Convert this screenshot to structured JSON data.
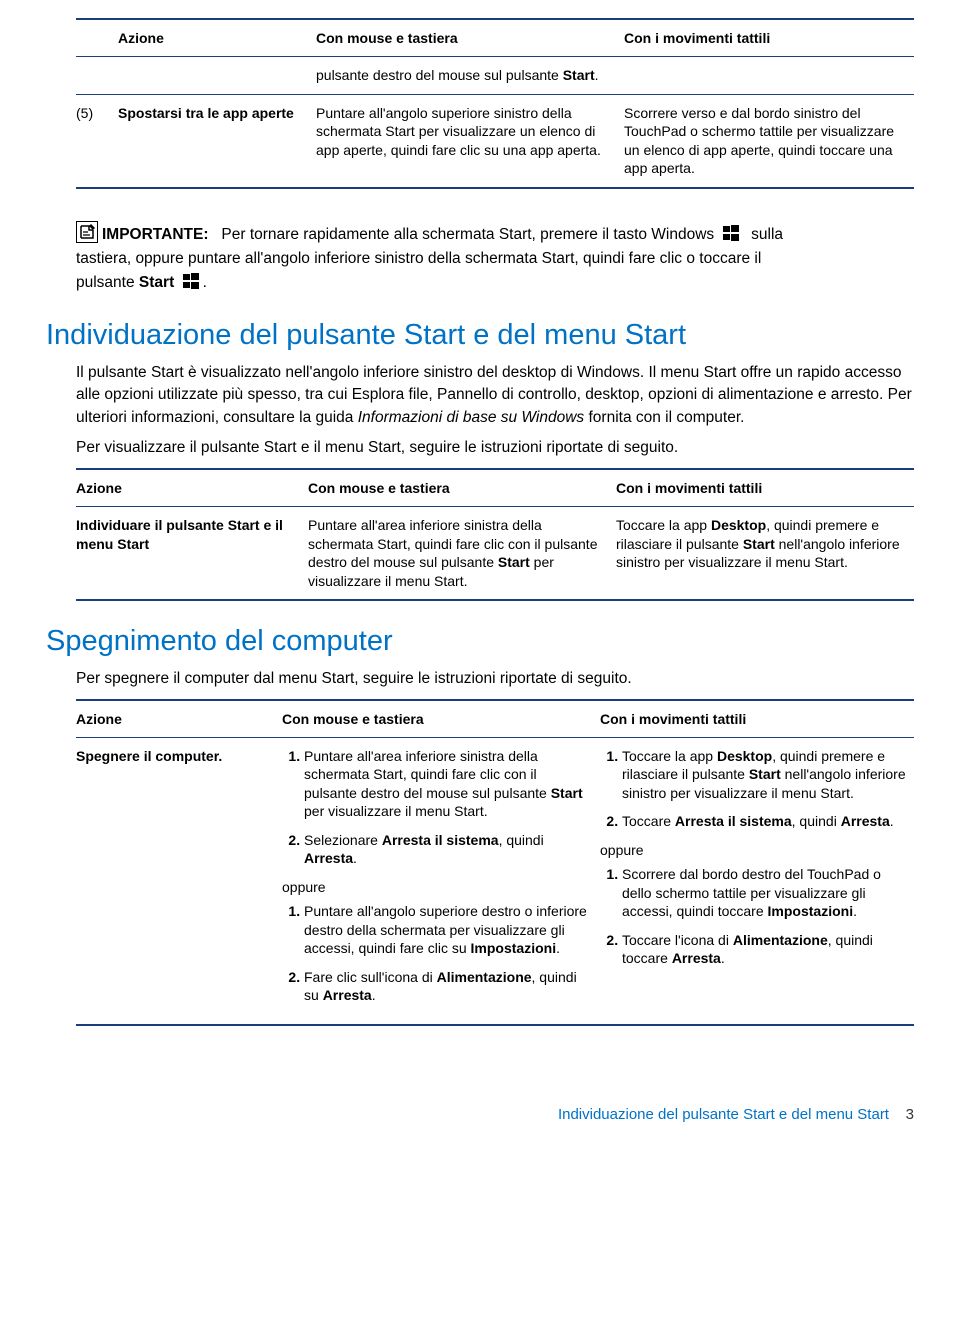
{
  "table1": {
    "h_azione": "Azione",
    "h_mouse": "Con mouse e tastiera",
    "h_touch": "Con i movimenti tattili",
    "row0_mouse_pre": "pulsante destro del mouse sul pulsante ",
    "row0_mouse_bold": "Start",
    "row0_mouse_post": ".",
    "row1_num": "(5)",
    "row1_azione": "Spostarsi tra le app aperte",
    "row1_mouse": "Puntare all'angolo superiore sinistro della schermata Start per visualizzare un elenco di app aperte, quindi fare clic su una app aperta.",
    "row1_touch": "Scorrere verso e dal bordo sinistro del TouchPad o schermo tattile per visualizzare un elenco di app aperte, quindi toccare una app aperta."
  },
  "important": {
    "label": "IMPORTANTE:",
    "p1a": "Per tornare rapidamente alla schermata Start, premere il tasto Windows",
    "p1b": "sulla",
    "p2a": "tastiera, oppure puntare all'angolo inferiore sinistro della schermata Start, quindi fare clic o toccare il",
    "p3a": "pulsante ",
    "p3b": "Start",
    "p3c": "."
  },
  "section_start": {
    "title": "Individuazione del pulsante Start e del menu Start",
    "p1_a": "Il pulsante Start è visualizzato nell'angolo inferiore sinistro del desktop di Windows. Il menu Start offre un rapido accesso alle opzioni utilizzate più spesso, tra cui Esplora file, Pannello di controllo, desktop, opzioni di alimentazione e arresto. Per ulteriori informazioni, consultare la guida ",
    "p1_i": "Informazioni di base su Windows",
    "p1_b": " fornita con il computer.",
    "p2": "Per visualizzare il pulsante Start e il menu Start, seguire le istruzioni riportate di seguito."
  },
  "table2": {
    "h_azione": "Azione",
    "h_mouse": "Con mouse e tastiera",
    "h_touch": "Con i movimenti tattili",
    "row1_azione": "Individuare il pulsante Start e il menu Start",
    "row1_mouse_a": "Puntare all'area inferiore sinistra della schermata Start, quindi fare clic con il pulsante destro del mouse sul pulsante ",
    "row1_mouse_b": "Start",
    "row1_mouse_c": " per visualizzare il menu Start.",
    "row1_touch_a": "Toccare la app ",
    "row1_touch_b": "Desktop",
    "row1_touch_c": ", quindi premere e rilasciare il pulsante ",
    "row1_touch_d": "Start",
    "row1_touch_e": " nell'angolo inferiore sinistro per visualizzare il menu Start."
  },
  "section_off": {
    "title": "Spegnimento del computer",
    "p1": "Per spegnere il computer dal menu Start, seguire le istruzioni riportate di seguito."
  },
  "table3": {
    "h_azione": "Azione",
    "h_mouse": "Con mouse e tastiera",
    "h_touch": "Con i movimenti tattili",
    "row1_azione": "Spegnere il computer.",
    "oppure": "oppure",
    "m_s1_a": "Puntare all'area inferiore sinistra della schermata Start, quindi fare clic con il pulsante destro del mouse sul pulsante ",
    "m_s1_b": "Start",
    "m_s1_c": " per visualizzare il menu Start.",
    "m_s2_a": "Selezionare ",
    "m_s2_b": "Arresta il sistema",
    "m_s2_c": ", quindi ",
    "m_s2_d": "Arresta",
    "m_s2_e": ".",
    "m_s3_a": "Puntare all'angolo superiore destro o inferiore destro della schermata per visualizzare gli accessi, quindi fare clic su ",
    "m_s3_b": "Impostazioni",
    "m_s3_c": ".",
    "m_s4_a": "Fare clic sull'icona di ",
    "m_s4_b": "Alimentazione",
    "m_s4_c": ", quindi su ",
    "m_s4_d": "Arresta",
    "m_s4_e": ".",
    "t_s1_a": "Toccare la app ",
    "t_s1_b": "Desktop",
    "t_s1_c": ", quindi premere e rilasciare il pulsante ",
    "t_s1_d": "Start",
    "t_s1_e": " nell'angolo inferiore sinistro per visualizzare il menu Start.",
    "t_s2_a": "Toccare ",
    "t_s2_b": "Arresta il sistema",
    "t_s2_c": ", quindi ",
    "t_s2_d": "Arresta",
    "t_s2_e": ".",
    "t_s3_a": "Scorrere dal bordo destro del TouchPad o dello schermo tattile per visualizzare gli accessi, quindi toccare ",
    "t_s3_b": "Impostazioni",
    "t_s3_c": ".",
    "t_s4_a": "Toccare l'icona di ",
    "t_s4_b": "Alimentazione",
    "t_s4_c": ", quindi toccare ",
    "t_s4_d": "Arresta",
    "t_s4_e": "."
  },
  "footer": {
    "text": "Individuazione del pulsante Start e del menu Start",
    "page": "3"
  }
}
